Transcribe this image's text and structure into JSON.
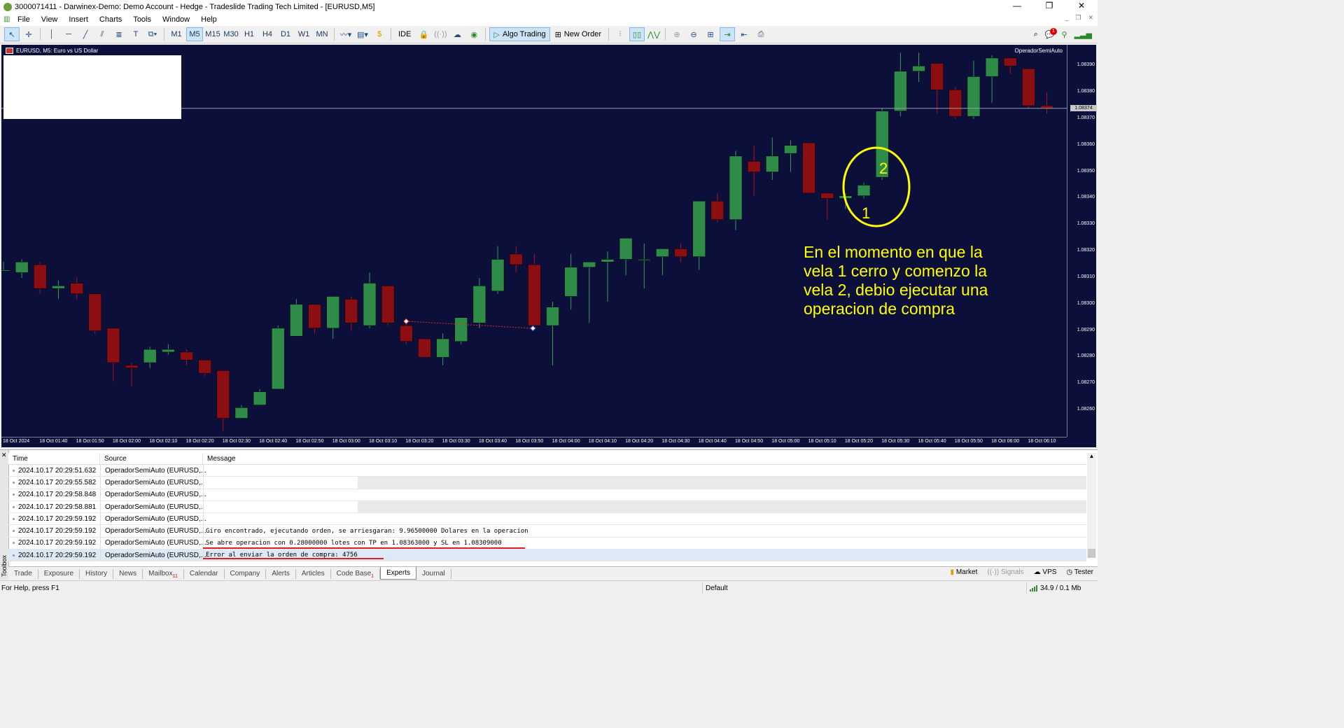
{
  "window": {
    "title": "3000071411 - Darwinex-Demo: Demo Account - Hedge - Tradeslide Trading Tech Limited - [EURUSD,M5]",
    "min": "—",
    "max": "❐",
    "close": "✕"
  },
  "menu": [
    "File",
    "View",
    "Insert",
    "Charts",
    "Tools",
    "Window",
    "Help"
  ],
  "toolbar": {
    "timeframes": [
      "M1",
      "M5",
      "M15",
      "M30",
      "H1",
      "H4",
      "D1",
      "W1",
      "MN"
    ],
    "active_timeframe": "M5",
    "ide": "IDE",
    "algo_trading": "Algo Trading",
    "new_order": "New Order"
  },
  "chart": {
    "symbol_label": "EURUSD, M5:  Euro vs US Dollar",
    "ea_label": "OperadorSemiAuto",
    "current_price": "1.08374",
    "price_ticks": [
      "1.08390",
      "1.08380",
      "1.08370",
      "1.08360",
      "1.08350",
      "1.08340",
      "1.08330",
      "1.08320",
      "1.08310",
      "1.08300",
      "1.08290",
      "1.08280",
      "1.08270",
      "1.08260"
    ],
    "time_ticks": [
      "18 Oct 2024",
      "18 Oct 01:40",
      "18 Oct 01:50",
      "18 Oct 02:00",
      "18 Oct 02:10",
      "18 Oct 02:20",
      "18 Oct 02:30",
      "18 Oct 02:40",
      "18 Oct 02:50",
      "18 Oct 03:00",
      "18 Oct 03:10",
      "18 Oct 03:20",
      "18 Oct 03:30",
      "18 Oct 03:40",
      "18 Oct 03:50",
      "18 Oct 04:00",
      "18 Oct 04:10",
      "18 Oct 04:20",
      "18 Oct 04:30",
      "18 Oct 04:40",
      "18 Oct 04:50",
      "18 Oct 05:00",
      "18 Oct 05:10",
      "18 Oct 05:20",
      "18 Oct 05:30",
      "18 Oct 05:40",
      "18 Oct 05:50",
      "18 Oct 06:00",
      "18 Oct 06:10"
    ],
    "annotation_1": "1",
    "annotation_2": "2",
    "annotation_text": "En el momento en que la vela 1 cerro y comenzo la vela 2, debio ejecutar una operacion de compra",
    "colors": {
      "background": "#0b0f3a",
      "bull": "#2e8b48",
      "bear": "#8b0f12",
      "annotation": "#ffff00"
    }
  },
  "chart_data": {
    "type": "candlestick",
    "symbol": "EURUSD",
    "timeframe": "M5",
    "ylim": [
      1.0825,
      1.08398
    ],
    "price_line": 1.08374,
    "candles": [
      {
        "o": 1.08313,
        "h": 1.08316,
        "l": 1.08313,
        "c": 1.08313
      },
      {
        "o": 1.08312,
        "h": 1.08317,
        "l": 1.0831,
        "c": 1.08316
      },
      {
        "o": 1.08315,
        "h": 1.08316,
        "l": 1.08304,
        "c": 1.08306
      },
      {
        "o": 1.08306,
        "h": 1.08309,
        "l": 1.08302,
        "c": 1.08307
      },
      {
        "o": 1.08308,
        "h": 1.0831,
        "l": 1.08302,
        "c": 1.08304
      },
      {
        "o": 1.08304,
        "h": 1.08304,
        "l": 1.08289,
        "c": 1.0829
      },
      {
        "o": 1.08291,
        "h": 1.08291,
        "l": 1.08271,
        "c": 1.08278
      },
      {
        "o": 1.08277,
        "h": 1.08278,
        "l": 1.08269,
        "c": 1.08276
      },
      {
        "o": 1.08278,
        "h": 1.08284,
        "l": 1.08276,
        "c": 1.08283
      },
      {
        "o": 1.08282,
        "h": 1.08285,
        "l": 1.08281,
        "c": 1.08283
      },
      {
        "o": 1.08282,
        "h": 1.08283,
        "l": 1.08277,
        "c": 1.08279
      },
      {
        "o": 1.08279,
        "h": 1.08279,
        "l": 1.08273,
        "c": 1.08274
      },
      {
        "o": 1.08275,
        "h": 1.08275,
        "l": 1.08252,
        "c": 1.08257
      },
      {
        "o": 1.08257,
        "h": 1.08262,
        "l": 1.08257,
        "c": 1.08261
      },
      {
        "o": 1.08262,
        "h": 1.08268,
        "l": 1.08262,
        "c": 1.08267
      },
      {
        "o": 1.08268,
        "h": 1.08292,
        "l": 1.08268,
        "c": 1.08291
      },
      {
        "o": 1.08288,
        "h": 1.08302,
        "l": 1.08288,
        "c": 1.083
      },
      {
        "o": 1.083,
        "h": 1.083,
        "l": 1.08289,
        "c": 1.08291
      },
      {
        "o": 1.08291,
        "h": 1.08303,
        "l": 1.08287,
        "c": 1.08303
      },
      {
        "o": 1.08302,
        "h": 1.08303,
        "l": 1.0829,
        "c": 1.08293
      },
      {
        "o": 1.08292,
        "h": 1.08312,
        "l": 1.08291,
        "c": 1.08308
      },
      {
        "o": 1.08307,
        "h": 1.08307,
        "l": 1.08292,
        "c": 1.08293
      },
      {
        "o": 1.08292,
        "h": 1.08293,
        "l": 1.08285,
        "c": 1.08286
      },
      {
        "o": 1.08287,
        "h": 1.08287,
        "l": 1.0828,
        "c": 1.0828
      },
      {
        "o": 1.0828,
        "h": 1.08289,
        "l": 1.08277,
        "c": 1.08287
      },
      {
        "o": 1.08286,
        "h": 1.08295,
        "l": 1.08285,
        "c": 1.08295
      },
      {
        "o": 1.08293,
        "h": 1.0831,
        "l": 1.08291,
        "c": 1.08307
      },
      {
        "o": 1.08305,
        "h": 1.08322,
        "l": 1.08304,
        "c": 1.08317
      },
      {
        "o": 1.08319,
        "h": 1.08322,
        "l": 1.08312,
        "c": 1.08315
      },
      {
        "o": 1.08315,
        "h": 1.08319,
        "l": 1.08292,
        "c": 1.08292
      },
      {
        "o": 1.08292,
        "h": 1.08301,
        "l": 1.08277,
        "c": 1.08299
      },
      {
        "o": 1.08303,
        "h": 1.08319,
        "l": 1.08298,
        "c": 1.08314
      },
      {
        "o": 1.08314,
        "h": 1.08316,
        "l": 1.08293,
        "c": 1.08316
      },
      {
        "o": 1.08316,
        "h": 1.0832,
        "l": 1.08301,
        "c": 1.08317
      },
      {
        "o": 1.08317,
        "h": 1.08325,
        "l": 1.08311,
        "c": 1.08325
      },
      {
        "o": 1.08317,
        "h": 1.08323,
        "l": 1.08306,
        "c": 1.08317
      },
      {
        "o": 1.08318,
        "h": 1.0832,
        "l": 1.08311,
        "c": 1.08321
      },
      {
        "o": 1.08321,
        "h": 1.08323,
        "l": 1.08316,
        "c": 1.08318
      },
      {
        "o": 1.08318,
        "h": 1.08338,
        "l": 1.08313,
        "c": 1.08339
      },
      {
        "o": 1.08339,
        "h": 1.08342,
        "l": 1.08331,
        "c": 1.08332
      },
      {
        "o": 1.08332,
        "h": 1.08358,
        "l": 1.08328,
        "c": 1.08356
      },
      {
        "o": 1.08354,
        "h": 1.0836,
        "l": 1.08341,
        "c": 1.0835
      },
      {
        "o": 1.0835,
        "h": 1.08363,
        "l": 1.08347,
        "c": 1.08356
      },
      {
        "o": 1.08357,
        "h": 1.08362,
        "l": 1.0835,
        "c": 1.0836
      },
      {
        "o": 1.08361,
        "h": 1.08361,
        "l": 1.08342,
        "c": 1.08342
      },
      {
        "o": 1.08342,
        "h": 1.08342,
        "l": 1.08332,
        "c": 1.0834
      },
      {
        "o": 1.0834,
        "h": 1.08342,
        "l": 1.08336,
        "c": 1.08341
      },
      {
        "o": 1.08341,
        "h": 1.08346,
        "l": 1.0834,
        "c": 1.08345
      },
      {
        "o": 1.08348,
        "h": 1.08374,
        "l": 1.08347,
        "c": 1.08373
      },
      {
        "o": 1.08373,
        "h": 1.08395,
        "l": 1.08371,
        "c": 1.08388
      },
      {
        "o": 1.08388,
        "h": 1.08395,
        "l": 1.08384,
        "c": 1.0839
      },
      {
        "o": 1.08391,
        "h": 1.08391,
        "l": 1.08372,
        "c": 1.08381
      },
      {
        "o": 1.08381,
        "h": 1.08382,
        "l": 1.0837,
        "c": 1.08371
      },
      {
        "o": 1.08371,
        "h": 1.08392,
        "l": 1.0837,
        "c": 1.08386
      },
      {
        "o": 1.08386,
        "h": 1.08394,
        "l": 1.08376,
        "c": 1.08393
      },
      {
        "o": 1.08393,
        "h": 1.08393,
        "l": 1.08387,
        "c": 1.0839
      },
      {
        "o": 1.08389,
        "h": 1.08389,
        "l": 1.08374,
        "c": 1.08375
      },
      {
        "o": 1.08375,
        "h": 1.0838,
        "l": 1.08372,
        "c": 1.08374
      }
    ]
  },
  "journal": {
    "headers": {
      "time": "Time",
      "source": "Source",
      "message": "Message"
    },
    "rows": [
      {
        "time": "2024.10.17 20:29:51.632",
        "source": "OperadorSemiAuto (EURUSD,...",
        "message": ""
      },
      {
        "time": "2024.10.17 20:29:55.582",
        "source": "OperadorSemiAuto (EURUSD,...",
        "message": ""
      },
      {
        "time": "2024.10.17 20:29:58.848",
        "source": "OperadorSemiAuto (EURUSD,...",
        "message": ""
      },
      {
        "time": "2024.10.17 20:29:58.881",
        "source": "OperadorSemiAuto (EURUSD,...",
        "message": ""
      },
      {
        "time": "2024.10.17 20:29:59.192",
        "source": "OperadorSemiAuto (EURUSD,...",
        "message": ""
      },
      {
        "time": "2024.10.17 20:29:59.192",
        "source": "OperadorSemiAuto (EURUSD,...",
        "message": "Giro encontrado, ejecutando orden, se arriesgaran: 9.96500000 Dolares en la operacion"
      },
      {
        "time": "2024.10.17 20:29:59.192",
        "source": "OperadorSemiAuto (EURUSD,...",
        "message": "Se abre operacion con 0.28000000 lotes con TP en 1.08363000 y SL en 1.08309000"
      },
      {
        "time": "2024.10.17 20:29:59.192",
        "source": "OperadorSemiAuto (EURUSD,...",
        "message": "Error al enviar la orden de compra: 4756"
      }
    ]
  },
  "toolbox": {
    "side_label": "Toolbox",
    "close_glyph": "✕",
    "tabs": [
      "Trade",
      "Exposure",
      "History",
      "News",
      "Mailbox",
      "Calendar",
      "Company",
      "Alerts",
      "Articles",
      "Code Base",
      "Experts",
      "Journal"
    ],
    "mailbox_badge": "11",
    "codebase_badge": "1",
    "active_tab": "Experts",
    "right_tabs": {
      "market": "Market",
      "signals": "Signals",
      "vps": "VPS",
      "tester": "Tester"
    }
  },
  "status": {
    "help": "For Help, press F1",
    "profile": "Default",
    "traffic": "34.9 / 0.1 Mb"
  },
  "badges": {
    "notifications": "1"
  }
}
